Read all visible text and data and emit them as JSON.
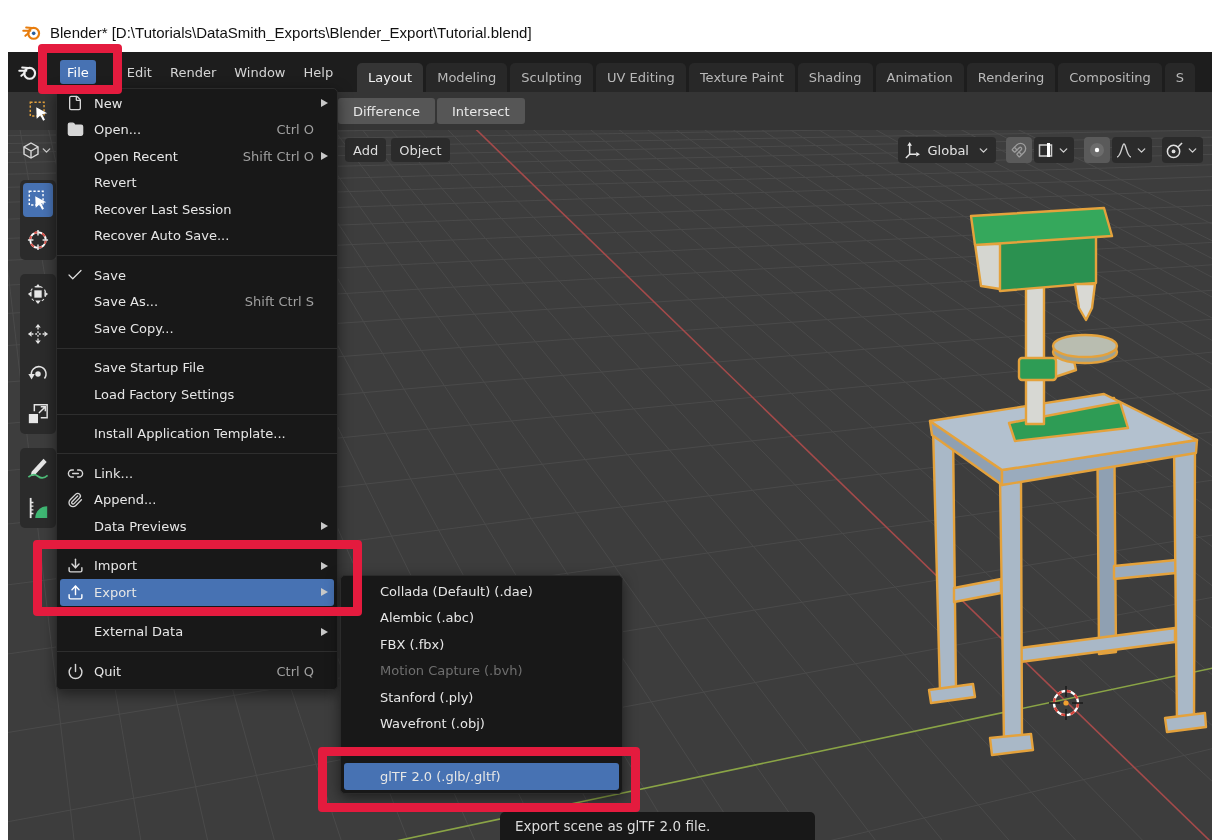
{
  "window": {
    "title": "Blender* [D:\\Tutorials\\DataSmith_Exports\\Blender_Export\\Tutorial.blend]"
  },
  "menu_bar": [
    {
      "label": "File",
      "selected": true
    },
    {
      "label": "Edit",
      "selected": false
    },
    {
      "label": "Render",
      "selected": false
    },
    {
      "label": "Window",
      "selected": false
    },
    {
      "label": "Help",
      "selected": false
    }
  ],
  "workspace_tabs": [
    {
      "label": "Layout",
      "selected": true
    },
    {
      "label": "Modeling",
      "selected": false
    },
    {
      "label": "Sculpting",
      "selected": false
    },
    {
      "label": "UV Editing",
      "selected": false
    },
    {
      "label": "Texture Paint",
      "selected": false
    },
    {
      "label": "Shading",
      "selected": false
    },
    {
      "label": "Animation",
      "selected": false
    },
    {
      "label": "Rendering",
      "selected": false
    },
    {
      "label": "Compositing",
      "selected": false
    },
    {
      "label": "S",
      "selected": false
    }
  ],
  "tool_header": {
    "buttons": [
      "Difference",
      "Intersect"
    ]
  },
  "viewport_header": {
    "menus": [
      "Add",
      "Object"
    ],
    "orientation": "Global"
  },
  "toolbar": {
    "groups": [
      [
        {
          "selected": true
        },
        {
          "selected": false
        }
      ],
      [
        {
          "selected": false
        },
        {
          "selected": false
        },
        {
          "selected": false
        },
        {
          "selected": false
        }
      ],
      [
        {
          "selected": false
        },
        {
          "selected": false
        }
      ]
    ]
  },
  "file_menu": {
    "sections": [
      [
        {
          "label": "New",
          "submenu": true,
          "selected": false
        },
        {
          "label": "Open...",
          "shortcut": "Ctrl O",
          "submenu": false,
          "selected": false
        },
        {
          "label": "Open Recent",
          "shortcut": "Shift Ctrl O",
          "submenu": true,
          "selected": false
        },
        {
          "label": "Revert",
          "submenu": false,
          "selected": false
        },
        {
          "label": "Recover Last Session",
          "submenu": false,
          "selected": false
        },
        {
          "label": "Recover Auto Save...",
          "submenu": false,
          "selected": false
        }
      ],
      [
        {
          "label": "Save",
          "submenu": false,
          "selected": false
        },
        {
          "label": "Save As...",
          "shortcut": "Shift Ctrl S",
          "submenu": false,
          "selected": false
        },
        {
          "label": "Save Copy...",
          "submenu": false,
          "selected": false
        }
      ],
      [
        {
          "label": "Save Startup File",
          "submenu": false,
          "selected": false
        },
        {
          "label": "Load Factory Settings",
          "submenu": false,
          "selected": false
        }
      ],
      [
        {
          "label": "Install Application Template...",
          "submenu": false,
          "selected": false
        }
      ],
      [
        {
          "label": "Link...",
          "submenu": false,
          "selected": false
        },
        {
          "label": "Append...",
          "submenu": false,
          "selected": false
        },
        {
          "label": "Data Previews",
          "submenu": true,
          "selected": false
        }
      ],
      [
        {
          "label": "Import",
          "submenu": true,
          "selected": false
        },
        {
          "label": "Export",
          "submenu": true,
          "selected": true
        }
      ],
      [
        {
          "label": "External Data",
          "submenu": true,
          "selected": false
        }
      ],
      [
        {
          "label": "Quit",
          "shortcut": "Ctrl Q",
          "submenu": false,
          "selected": false
        }
      ]
    ]
  },
  "export_submenu": {
    "sections": [
      [
        {
          "label": "Collada (Default) (.dae)",
          "disabled": false,
          "selected": false
        },
        {
          "label": "Alembic (.abc)",
          "disabled": false,
          "selected": false
        },
        {
          "label": "FBX (.fbx)",
          "disabled": false,
          "selected": false
        },
        {
          "label": "Motion Capture (.bvh)",
          "disabled": true,
          "selected": false
        },
        {
          "label": "Stanford (.ply)",
          "disabled": false,
          "selected": false
        },
        {
          "label": "Wavefront (.obj)",
          "disabled": false,
          "selected": false
        }
      ],
      [
        {
          "label": "glTF 2.0 (.glb/.gltf)",
          "disabled": false,
          "selected": true
        }
      ]
    ]
  },
  "tooltip": {
    "text": "Export scene as glTF 2.0 file."
  }
}
